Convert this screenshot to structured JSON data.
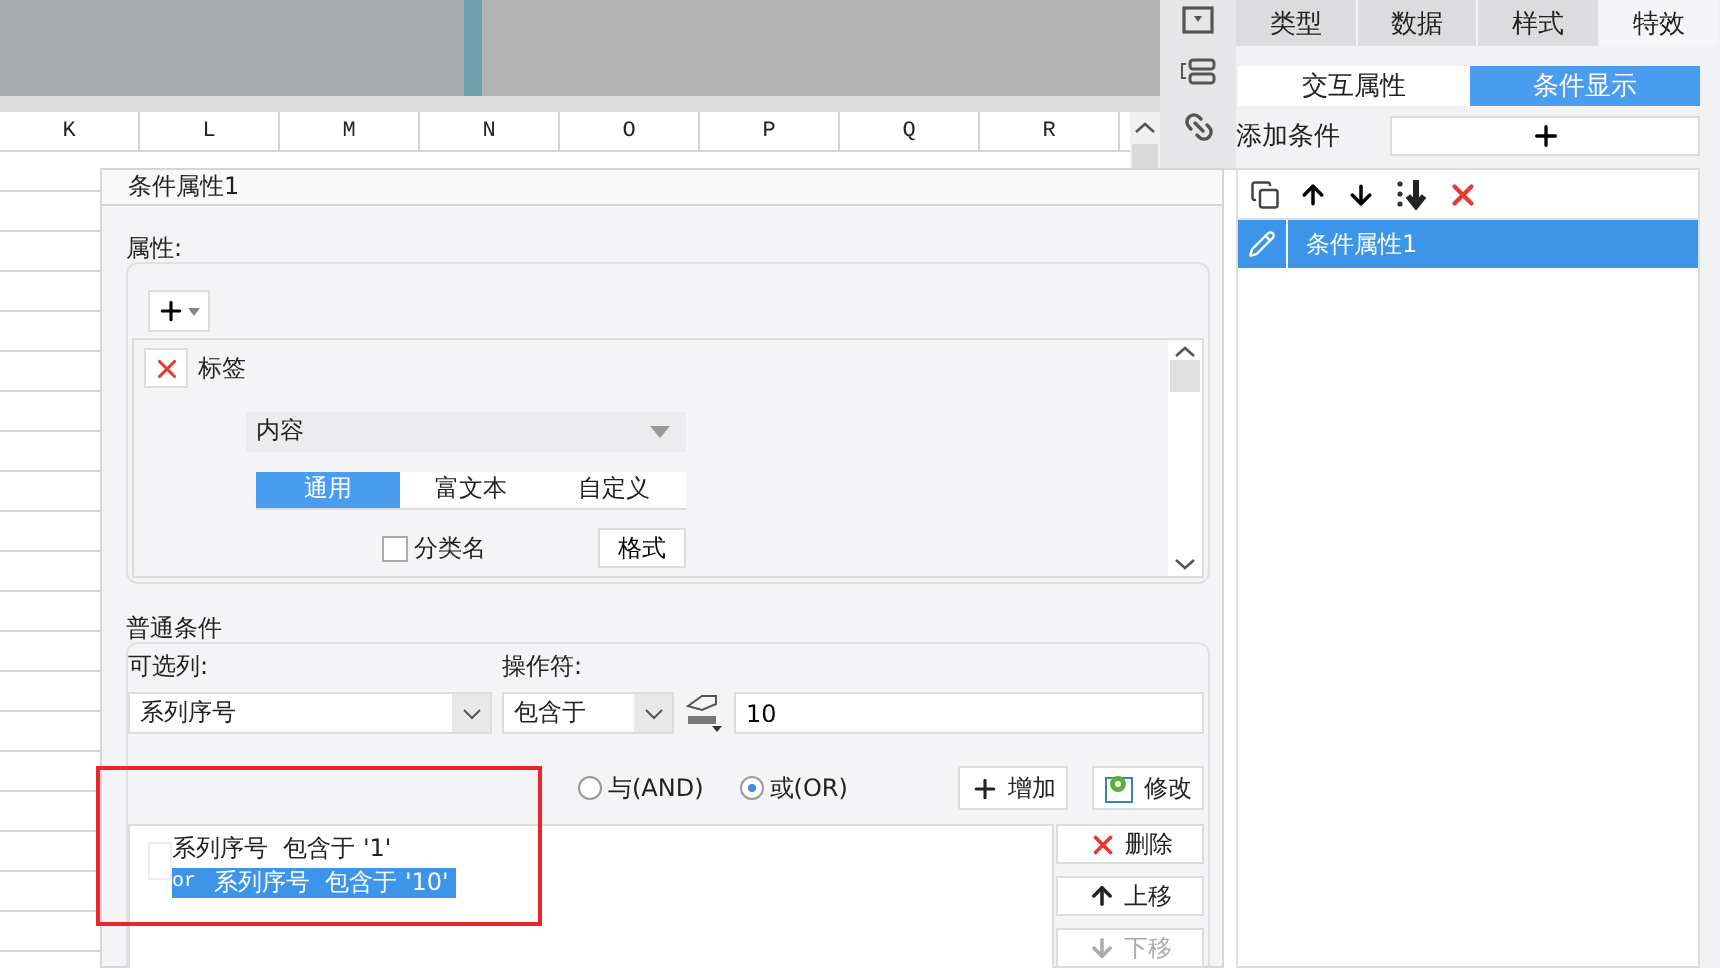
{
  "spreadsheet": {
    "columns": [
      "K",
      "L",
      "M",
      "N",
      "O",
      "P",
      "Q",
      "R"
    ]
  },
  "dialog": {
    "title": "条件属性1",
    "properties": {
      "legend": "属性:",
      "items": [
        {
          "label": "标签",
          "field": {
            "value": "内容"
          },
          "tabs": [
            {
              "label": "通用",
              "selected": true
            },
            {
              "label": "富文本",
              "selected": false
            },
            {
              "label": "自定义",
              "selected": false
            }
          ],
          "checkbox": {
            "label": "分类名",
            "checked": false
          },
          "format_button": "格式"
        }
      ]
    },
    "condition": {
      "legend": "普通条件",
      "column_label": "可选列:",
      "column_value": "系列序号",
      "operator_label": "操作符:",
      "operator_value": "包含于",
      "value": "10",
      "logic": [
        {
          "label": "与(AND)",
          "selected": false
        },
        {
          "label": "或(OR)",
          "selected": true
        }
      ],
      "buttons": [
        {
          "label": "增加",
          "kind": "add"
        },
        {
          "label": "修改",
          "kind": "edit"
        }
      ],
      "list": [
        {
          "text": "系列序号  包含于 '1'",
          "selected": false
        },
        {
          "prefix": "or",
          "text": "系列序号  包含于 '10'",
          "selected": true
        }
      ],
      "side_buttons": [
        {
          "label": "删除",
          "kind": "delete",
          "disabled": false
        },
        {
          "label": "上移",
          "kind": "up",
          "disabled": false
        },
        {
          "label": "下移",
          "kind": "down",
          "disabled": true
        }
      ]
    }
  },
  "sidebar": {
    "tabs": [
      {
        "label": "类型",
        "selected": false
      },
      {
        "label": "数据",
        "selected": false
      },
      {
        "label": "样式",
        "selected": false
      },
      {
        "label": "特效",
        "selected": true
      }
    ],
    "subtabs": [
      {
        "label": "交互属性",
        "selected": false
      },
      {
        "label": "条件显示",
        "selected": true
      }
    ],
    "add_label": "添加条件",
    "items": [
      {
        "label": "条件属性1",
        "selected": true
      }
    ]
  }
}
